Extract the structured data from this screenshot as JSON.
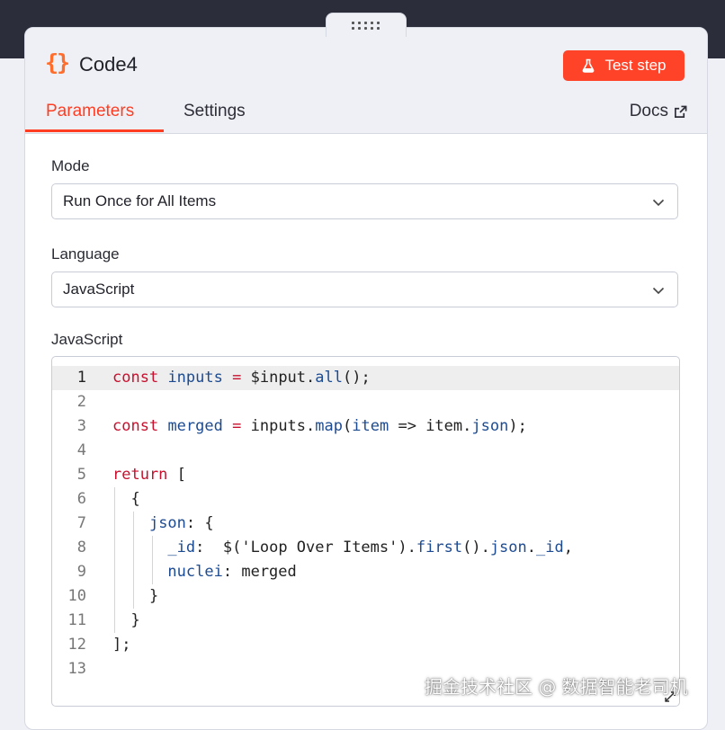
{
  "node": {
    "icon": "{}",
    "title": "Code4",
    "test_button_label": "Test step"
  },
  "tabs": [
    {
      "label": "Parameters",
      "active": true
    },
    {
      "label": "Settings",
      "active": false
    }
  ],
  "docs_label": "Docs",
  "mode": {
    "label": "Mode",
    "value": "Run Once for All Items"
  },
  "language": {
    "label": "Language",
    "value": "JavaScript"
  },
  "editor": {
    "label": "JavaScript",
    "active_line": 1,
    "line_numbers": [
      "1",
      "2",
      "3",
      "4",
      "5",
      "6",
      "7",
      "8",
      "9",
      "10",
      "11",
      "12",
      "13"
    ],
    "lines": [
      "const inputs = $input.all();",
      "",
      "const merged = inputs.map(item => item.json);",
      "",
      "return [",
      "  {",
      "    json: {",
      "      _id:  $('Loop Over Items').first().json._id,",
      "      nuclei: merged",
      "    }",
      "  }",
      "];",
      ""
    ]
  },
  "watermark": "掘金技术社区 @ 数据智能老司机",
  "colors": {
    "accent": "#ff3d23",
    "button": "#ff4329",
    "icon_orange": "#ff6d2d",
    "keyword": "#c8102e",
    "variable": "#1d4b91"
  },
  "icons": [
    "drag-handle-icon",
    "code-braces-icon",
    "flask-icon",
    "external-link-icon",
    "chevron-down-icon",
    "resize-handle-icon"
  ]
}
